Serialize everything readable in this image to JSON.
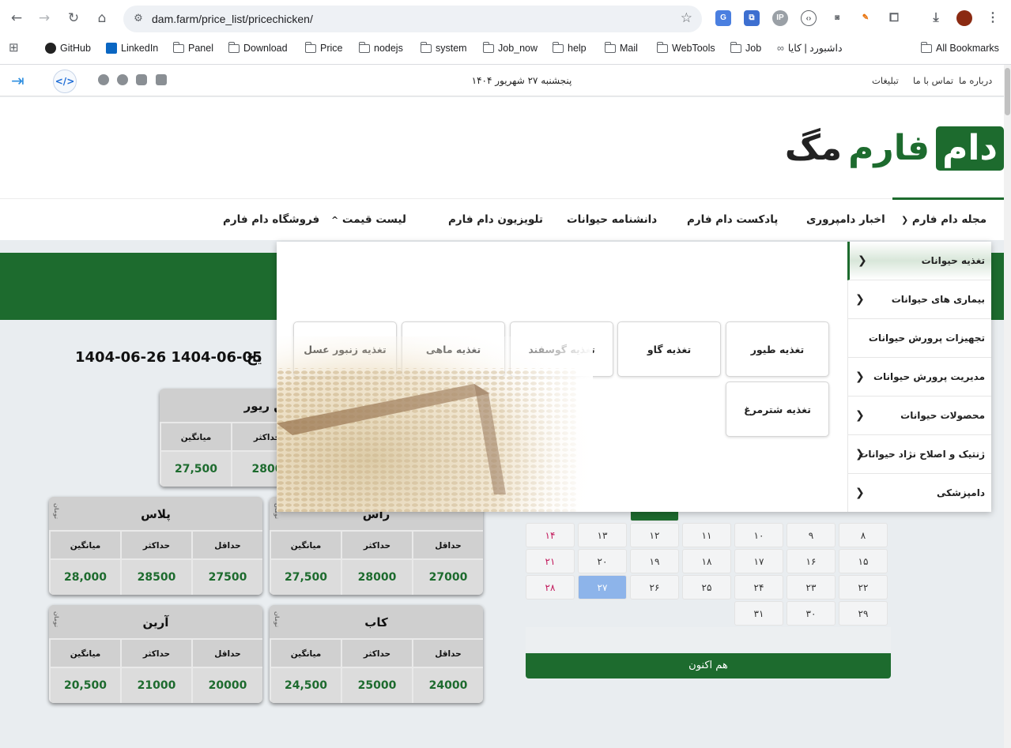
{
  "browser": {
    "url": "dam.farm/price_list/pricechicken/",
    "bookmarks": [
      "GitHub",
      "LinkedIn",
      "Panel",
      "Download",
      "Price",
      "nodejs",
      "system",
      "Job_now",
      "help",
      "Mail",
      "WebTools",
      "Job",
      "داشبورد | کایا",
      "All Bookmarks"
    ]
  },
  "topbar": {
    "links": [
      "درباره ما",
      "تماس با ما",
      "تبلیغات"
    ],
    "date": "پنجشنبه ۲۷ شهریور ۱۴۰۴"
  },
  "logo": {
    "part1": "دام",
    "part2": "فارم",
    "part3": "مگ"
  },
  "nav": {
    "items": [
      "مجله دام فارم",
      "اخبار دامپروری",
      "پادکست دام فارم",
      "دانشنامه حیوانات",
      "تلویزیون دام فارم",
      "لیست قیمت",
      "فروشگاه دام فارم"
    ]
  },
  "mega_menu": {
    "side_items": [
      "تغذیه حیوانات",
      "بیماری های حیوانات",
      "تجهیزات پرورش حیوانات",
      "مدیریت پرورش حیوانات",
      "محصولات حیوانات",
      "ژنتیک و اصلاح نژاد حیوانات",
      "دامپزشکی"
    ],
    "sub_items": [
      "تغذیه طیور",
      "تغذیه گاو",
      "تغذیه گوسفند",
      "تغذیه ماهی",
      "تغذیه زنبور عسل",
      "تغذیه شترمرغ"
    ]
  },
  "price": {
    "date_range": "1404-06-26   1404-06-05",
    "date_label_tail": "یخ",
    "headers": [
      "حداقل",
      "حداکثر",
      "میانگین"
    ],
    "unit": "تومان",
    "cards": [
      {
        "name": "ین ریور",
        "min": "",
        "max": "2800",
        "avg": "27,500"
      },
      {
        "name": "راس",
        "min": "27000",
        "max": "28000",
        "avg": "27,500"
      },
      {
        "name": "پلاس",
        "min": "27500",
        "max": "28500",
        "avg": "28,000"
      },
      {
        "name": "کاب",
        "min": "24000",
        "max": "25000",
        "avg": "24,500"
      },
      {
        "name": "آرین",
        "min": "20000",
        "max": "21000",
        "avg": "20,500"
      }
    ]
  },
  "calendar": {
    "rows": [
      [
        "۸",
        "۹",
        "۱۰",
        "۱۱",
        "۱۲",
        "۱۳",
        "۱۴"
      ],
      [
        "۱۵",
        "۱۶",
        "۱۷",
        "۱۸",
        "۱۹",
        "۲۰",
        "۲۱"
      ],
      [
        "۲۲",
        "۲۳",
        "۲۴",
        "۲۵",
        "۲۶",
        "۲۷",
        "۲۸"
      ],
      [
        "۲۹",
        "۳۰",
        "۳۱"
      ]
    ],
    "today": "۲۷",
    "now_button": "هم اکنون"
  },
  "colors": {
    "brand_green": "#1d6b2e",
    "today_blue": "#8db4ea",
    "friday": "#c2185b"
  }
}
